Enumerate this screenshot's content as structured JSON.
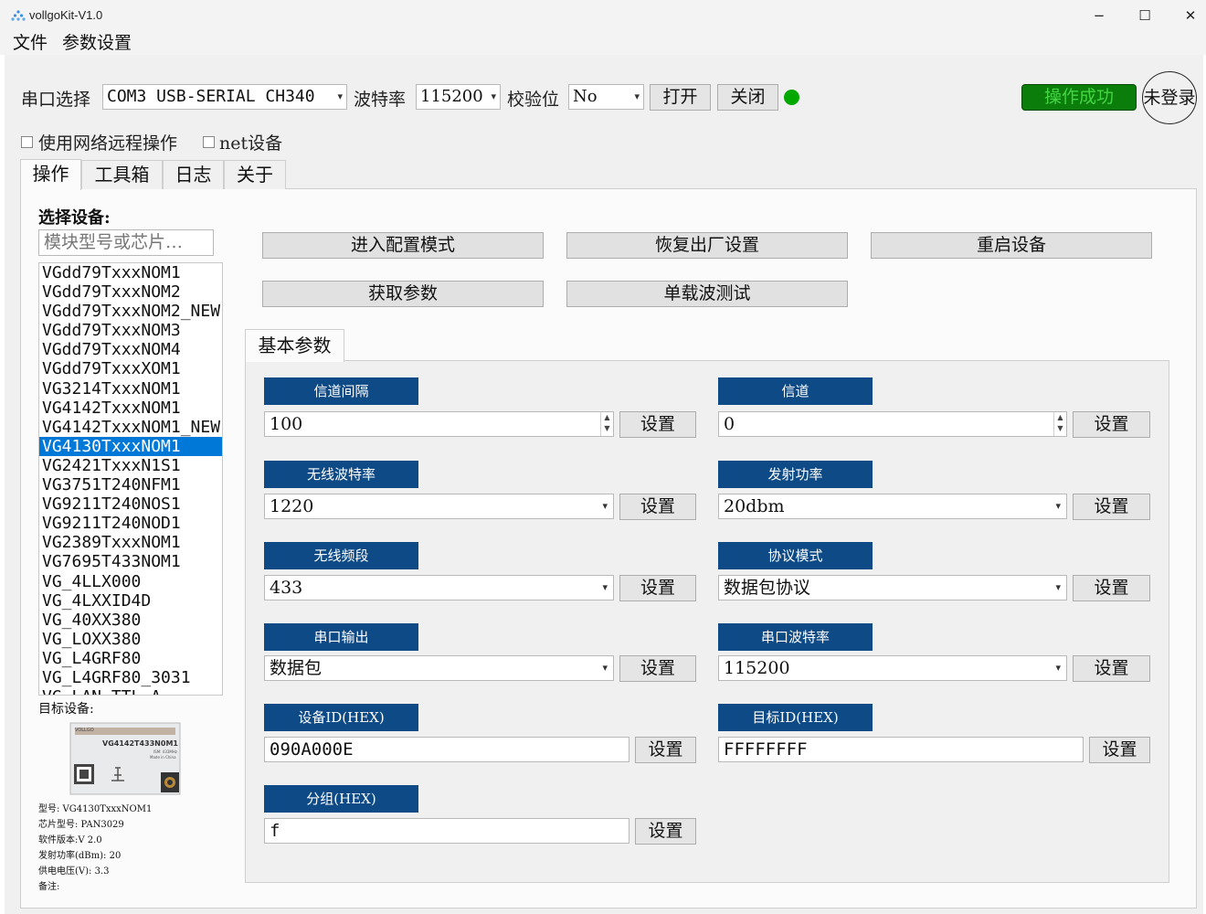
{
  "window": {
    "title": "vollgoKit-V1.0",
    "minimize": "−",
    "maximize": "☐",
    "close": "✕"
  },
  "menu": [
    "文件",
    "参数设置"
  ],
  "serial": {
    "port_label": "串口选择",
    "port_value": "COM3 USB-SERIAL CH340",
    "baud_label": "波特率",
    "baud_value": "115200",
    "parity_label": "校验位",
    "parity_value": "No",
    "open_label": "打开",
    "close_label": "关闭",
    "status_color": "#00a800"
  },
  "status": {
    "success_label": "操作成功",
    "login_label": "未登录"
  },
  "options": {
    "remote_label": "使用网络远程操作",
    "net_label": "net设备"
  },
  "tabs": [
    "操作",
    "工具箱",
    "日志",
    "关于"
  ],
  "device": {
    "select_label": "选择设备:",
    "search_placeholder": "模块型号或芯片…",
    "list": [
      "VGdd79TxxxNOM1",
      "VGdd79TxxxNOM2",
      "VGdd79TxxxNOM2_NEW",
      "VGdd79TxxxNOM3",
      "VGdd79TxxxNOM4",
      "VGdd79TxxxXOM1",
      "VG3214TxxxNOM1",
      "VG4142TxxxNOM1",
      "VG4142TxxxNOM1_NEW",
      "VG4130TxxxNOM1",
      "VG2421TxxxN1S1",
      "VG3751T240NFM1",
      "VG9211T240NOS1",
      "VG9211T240NOD1",
      "VG2389TxxxNOM1",
      "VG7695T433NOM1",
      "VG_4LLX000",
      "VG_4LXXID4D",
      "VG_40XX380",
      "VG_LOXX380",
      "VG_L4GRF80",
      "VG_L4GRF80_3031",
      "VG_LAN_TTL_A"
    ],
    "selected_index": 9,
    "target_label": "目标设备:",
    "module_brand": "VOLLGO",
    "module_name": "VG4142T433N0M1",
    "module_sub1": "ISM: 433MHz",
    "module_sub2": "Made in China",
    "info": [
      "型号: VG4130TxxxNOM1",
      "芯片型号: PAN3029",
      "软件版本:V 2.0",
      "发射功率(dBm): 20",
      "供电电压(V): 3.3",
      "备注:"
    ]
  },
  "actions": {
    "enter_config": "进入配置模式",
    "factory_reset": "恢复出厂设置",
    "reboot": "重启设备",
    "get_params": "获取参数",
    "carrier_test": "单载波测试"
  },
  "params": {
    "group_tab": "基本参数",
    "set_label": "设置",
    "channel_spacing": {
      "label": "信道间隔",
      "value": "100"
    },
    "channel": {
      "label": "信道",
      "value": "0"
    },
    "air_rate": {
      "label": "无线波特率",
      "value": "1220"
    },
    "tx_power": {
      "label": "发射功率",
      "value": "20dbm"
    },
    "band": {
      "label": "无线频段",
      "value": "433"
    },
    "protocol": {
      "label": "协议模式",
      "value": "数据包协议"
    },
    "uart_output": {
      "label": "串口输出",
      "value": "数据包"
    },
    "uart_baud": {
      "label": "串口波特率",
      "value": "115200"
    },
    "device_id": {
      "label": "设备ID(HEX)",
      "value": "090A000E"
    },
    "target_id": {
      "label": "目标ID(HEX)",
      "value": "FFFFFFFF"
    },
    "group": {
      "label": "分组(HEX)",
      "value": "f"
    }
  },
  "colors": {
    "param_label_bg": "#0d4a86",
    "success_bg": "#0a7d0a",
    "selection": "#0078d7"
  }
}
